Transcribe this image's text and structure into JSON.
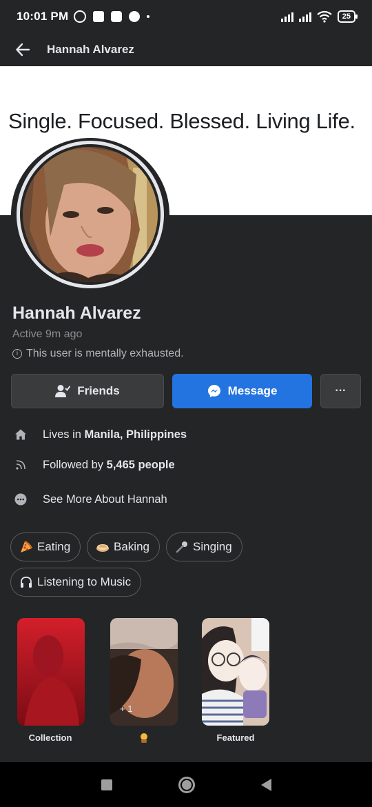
{
  "status_bar": {
    "time": "10:01 PM",
    "battery": "25"
  },
  "header": {
    "title": "Hannah Alvarez"
  },
  "cover": {
    "text": "Single. Focused. Blessed. Living Life."
  },
  "profile": {
    "name": "Hannah Alvarez",
    "active": "Active 9m ago",
    "note": "This user is mentally exhausted."
  },
  "actions": {
    "friends_label": "Friends",
    "message_label": "Message",
    "more_label": "···"
  },
  "details": {
    "lives_prefix": "Lives in ",
    "lives_place": "Manila, Philippines",
    "followed_prefix": "Followed by ",
    "followed_count": "5,465 people",
    "see_more": "See More About Hannah"
  },
  "hobbies": [
    {
      "label": "Eating",
      "icon": "pizza-icon"
    },
    {
      "label": "Baking",
      "icon": "pie-icon"
    },
    {
      "label": "Singing",
      "icon": "microphone-icon"
    },
    {
      "label": "Listening to Music",
      "icon": "headphones-icon"
    }
  ],
  "highlights": [
    {
      "label": "Collection",
      "overlay": ""
    },
    {
      "label": "",
      "overlay": "+ 1"
    },
    {
      "label": "Featured",
      "overlay": ""
    }
  ],
  "colors": {
    "background": "#242526",
    "accent": "#2374e1",
    "text_primary": "#e4e6eb",
    "text_secondary": "#b0b3b8"
  }
}
